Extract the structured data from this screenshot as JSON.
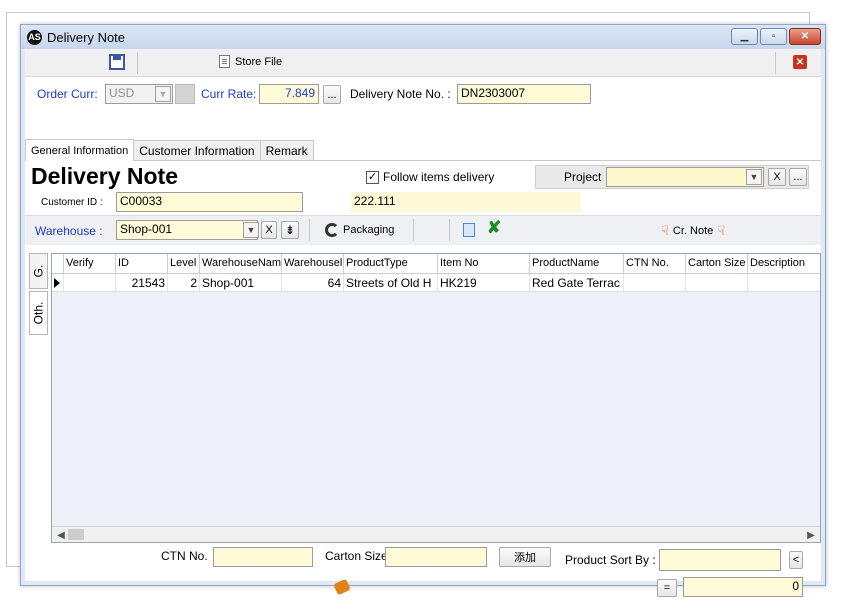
{
  "window": {
    "title": "Delivery Note",
    "app_icon": "AS"
  },
  "toolbar": {
    "store_file_label": "Store File"
  },
  "header": {
    "order_curr_label": "Order Curr:",
    "order_curr_value": "USD",
    "curr_rate_label": "Curr Rate:",
    "curr_rate_value": "7.849",
    "ellipsis": "...",
    "delivery_note_no_label": "Delivery Note No. :",
    "delivery_note_no_value": "DN2303007"
  },
  "tabs": [
    "General Information",
    "Customer Information",
    "Remark"
  ],
  "general": {
    "heading": "Delivery Note",
    "follow_items_label": "Follow items delivery",
    "follow_items_checked": "✓",
    "project_label": "Project",
    "project_value": "",
    "x_label": "X",
    "ellipsis": "...",
    "customer_id_label": "Customer ID :",
    "customer_id_value": "C00033",
    "customer_name_value": "222.111",
    "warehouse_label": "Warehouse :",
    "warehouse_value": "Shop-001",
    "packaging_label": "Packaging",
    "cr_note_label": "Cr. Note"
  },
  "side_tabs": [
    "G.",
    "Oth."
  ],
  "grid": {
    "columns": [
      "Verify",
      "ID",
      "Level",
      "WarehouseNam",
      "Warehousel",
      "ProductType",
      "Item No",
      "ProductName",
      "CTN No.",
      "Carton Size",
      "Description"
    ],
    "rows": [
      [
        "",
        "21543",
        "2",
        "Shop-001",
        "64",
        "Streets of Old H",
        "HK219",
        "Red Gate Terrac",
        "",
        "",
        ""
      ]
    ]
  },
  "footer": {
    "ctn_no_label": "CTN No.",
    "ctn_no_value": "",
    "carton_size_label": "Carton Size",
    "carton_size_value": "",
    "add_label": "添加",
    "product_sort_label": "Product Sort By :",
    "product_sort_value": "",
    "lt_label": "<",
    "eq_label": "=",
    "total_value": "0"
  },
  "colors": {
    "accent_blue": "#1c3fc0",
    "field_yellow": "#fffbd8",
    "window_frame": "#dfe9f5"
  }
}
